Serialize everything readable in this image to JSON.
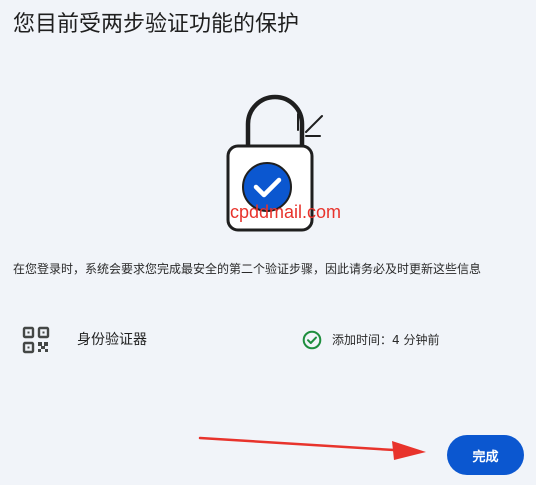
{
  "header": {
    "title": "您目前受两步验证功能的保护"
  },
  "illustration": {
    "icon": "padlock-with-check-icon",
    "accent_color": "#0b57d0"
  },
  "watermark": {
    "text": "cpddmail.com",
    "color": "#e8332c"
  },
  "description": "在您登录时，系统会要求您完成最安全的第二个验证步骤，因此请务必及时更新这些信息",
  "method": {
    "icon": "qr-code-icon",
    "name": "身份验证器",
    "status_icon": "check-circle-icon",
    "status_color": "#1e8e3e",
    "added_text": "添加时间：4 分钟前"
  },
  "annotation": {
    "icon": "red-arrow-icon",
    "color": "#e8332c"
  },
  "footer": {
    "done_label": "完成",
    "button_color": "#0b57d0"
  }
}
